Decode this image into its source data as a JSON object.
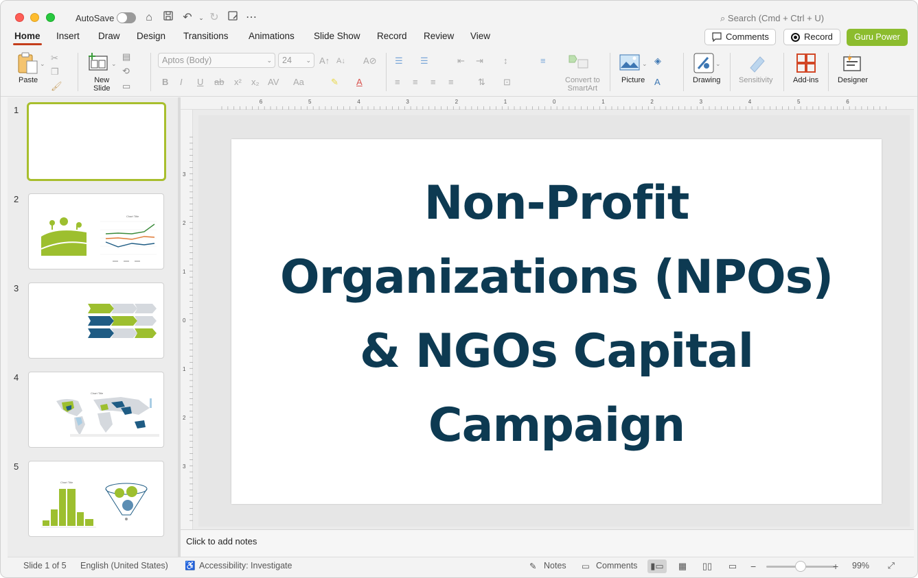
{
  "titlebar": {
    "autosave_label": "AutoSave",
    "search_placeholder": "Search (Cmd + Ctrl + U)"
  },
  "tabs": [
    "Home",
    "Insert",
    "Draw",
    "Design",
    "Transitions",
    "Animations",
    "Slide Show",
    "Record",
    "Review",
    "View"
  ],
  "active_tab": "Home",
  "buttons": {
    "comments": "Comments",
    "record": "Record",
    "guru": "Guru Power"
  },
  "ribbon": {
    "paste": "Paste",
    "new_slide_line1": "New",
    "new_slide_line2": "Slide",
    "font_name": "Aptos (Body)",
    "font_size": "24",
    "convert_line1": "Convert to",
    "convert_line2": "SmartArt",
    "picture": "Picture",
    "drawing": "Drawing",
    "sensitivity": "Sensitivity",
    "addins": "Add-ins",
    "designer": "Designer"
  },
  "thumbnails": [
    {
      "num": "1"
    },
    {
      "num": "2",
      "chart_title": "Chart Title"
    },
    {
      "num": "3"
    },
    {
      "num": "4",
      "chart_title": "Chart Title"
    },
    {
      "num": "5",
      "chart_title": "Chart Title"
    }
  ],
  "ruler": {
    "h_ticks": [
      "6",
      "5",
      "4",
      "3",
      "2",
      "1",
      "0",
      "1",
      "2",
      "3",
      "4",
      "5",
      "6"
    ],
    "v_ticks": [
      "3",
      "2",
      "1",
      "0",
      "1",
      "2",
      "3"
    ]
  },
  "slide": {
    "title_lines": [
      "Non-Profit",
      "Organizations (NPOs)",
      "& NGOs Capital",
      "Campaign"
    ]
  },
  "notes_placeholder": "Click to add notes",
  "status": {
    "slide_info": "Slide 1 of 5",
    "language": "English (United States)",
    "accessibility": "Accessibility: Investigate",
    "notes": "Notes",
    "comments": "Comments",
    "zoom": "99%"
  },
  "colors": {
    "accent": "#c43e1c",
    "guru": "#8cbc2e",
    "title": "#0d3a52",
    "thumb_green": "#9dbf2f",
    "thumb_blue": "#1f5c84"
  }
}
